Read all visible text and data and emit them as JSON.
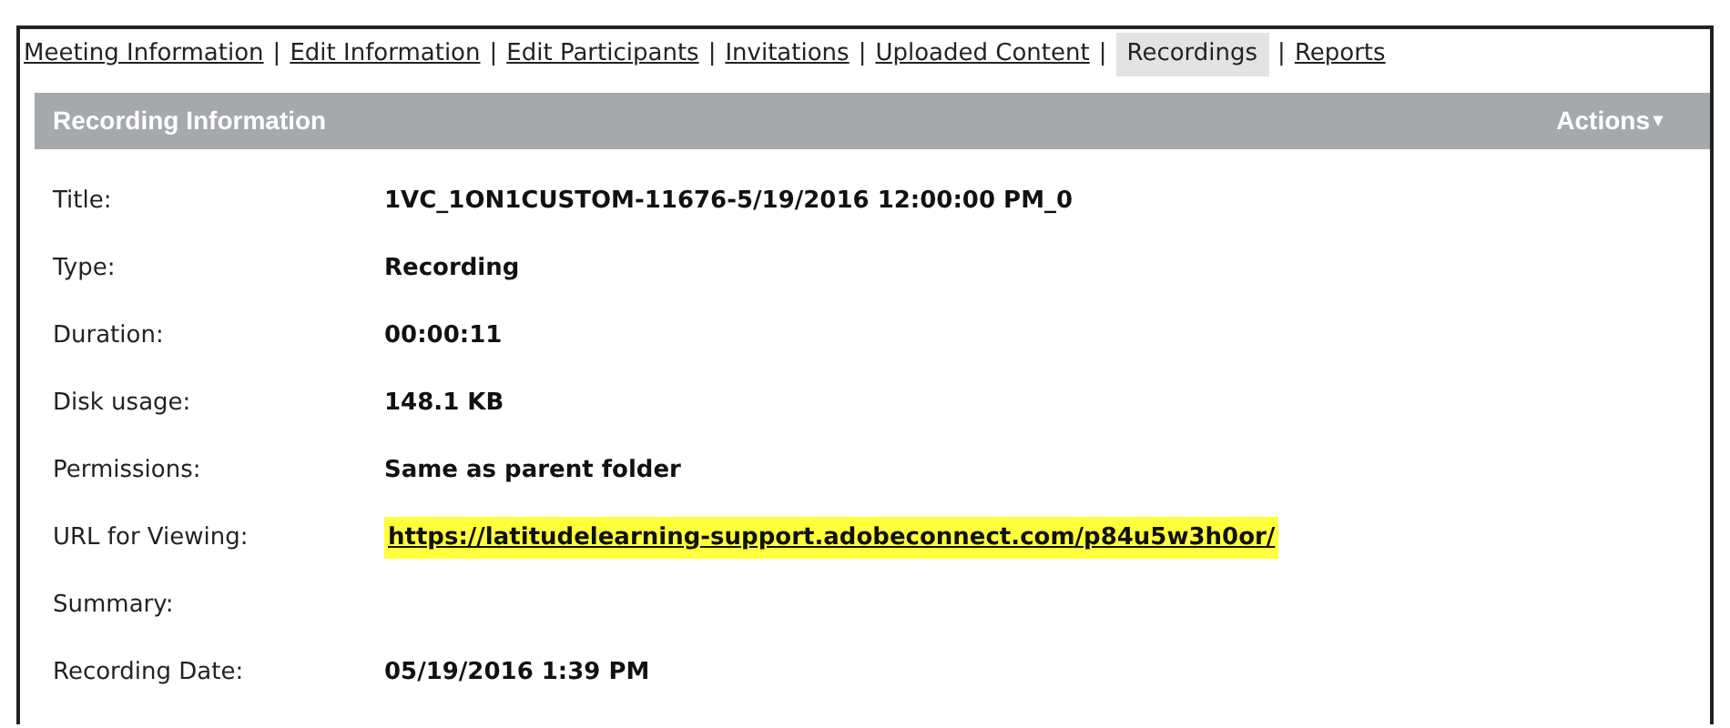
{
  "tabs": [
    {
      "label": "Meeting Information",
      "selected": false,
      "separator": "|"
    },
    {
      "label": "Edit Information",
      "selected": false,
      "separator": "|"
    },
    {
      "label": "Edit Participants",
      "selected": false,
      "separator": "|"
    },
    {
      "label": "Invitations",
      "selected": false,
      "separator": "|"
    },
    {
      "label": "Uploaded Content",
      "selected": false,
      "separator": "|"
    },
    {
      "label": "Recordings",
      "selected": true,
      "separator": "|"
    },
    {
      "label": "Reports",
      "selected": false
    }
  ],
  "panel": {
    "title": "Recording Information",
    "actions": "Actions",
    "actions_caret": "▾"
  },
  "fields": [
    {
      "label": "Title:",
      "value": "1VC_1ON1CUSTOM-11676-5/19/2016 12:00:00 PM_0",
      "kind": "text"
    },
    {
      "label": "Type:",
      "value": "Recording",
      "kind": "text"
    },
    {
      "label": "Duration:",
      "value": "00:00:11",
      "kind": "text"
    },
    {
      "label": "Disk usage:",
      "value": "148.1 KB",
      "kind": "text"
    },
    {
      "label": "Permissions:",
      "value": "Same as parent folder",
      "kind": "text"
    },
    {
      "label": "URL for Viewing:",
      "value": "https://latitudelearning-support.adobeconnect.com/p84u5w3h0or/",
      "kind": "link",
      "highlighted": true
    },
    {
      "label": "Summary:"
    },
    {
      "label": "Recording Date:",
      "value": "05/19/2016 1:39 PM",
      "kind": "text"
    }
  ]
}
